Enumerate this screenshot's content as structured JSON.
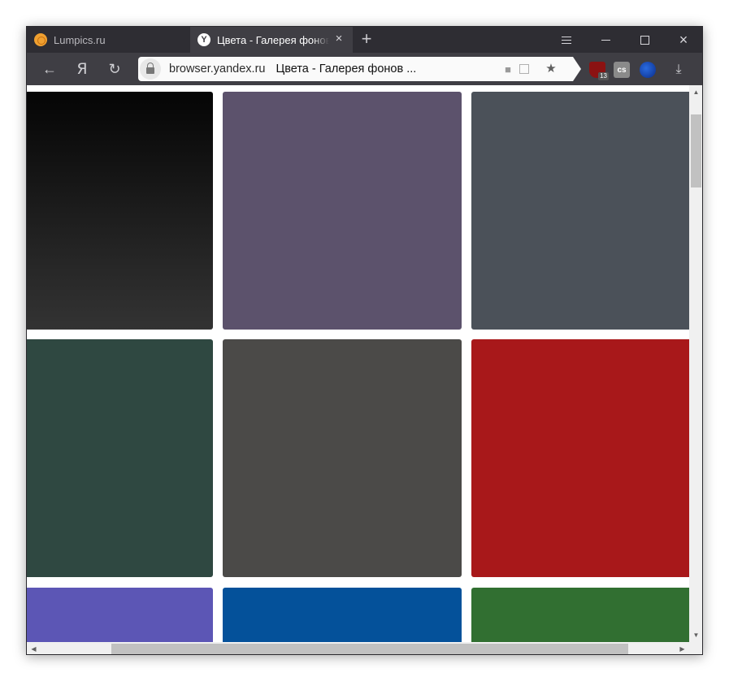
{
  "tabs": [
    {
      "title": "Lumpics.ru",
      "favicon": "lumpics-orange-icon",
      "active": false
    },
    {
      "title": "Цвета - Галерея фонов",
      "favicon": "yandex-y-icon",
      "active": true
    }
  ],
  "new_tab_icon": "plus-icon",
  "window_controls": [
    "menu-icon",
    "minimize-icon",
    "maximize-icon",
    "close-icon"
  ],
  "toolbar": {
    "back_icon": "←",
    "yandex_icon": "Я",
    "reload_icon": "↻",
    "address": {
      "domain": "browser.yandex.ru",
      "page_title": "Цвета - Галерея фонов ..."
    },
    "icons": [
      "chat-icon",
      "translate-icon",
      "star-icon"
    ],
    "extensions": [
      {
        "name": "ublock-origin-icon",
        "badge": "13"
      },
      {
        "name": "lastpass-icon",
        "label": "cs"
      },
      {
        "name": "vpn-globe-icon"
      },
      {
        "name": "download-icon"
      }
    ]
  },
  "gallery": {
    "tiles": [
      {
        "name": "tile-black-gradient",
        "color": "linear-gradient(#050505, #333333)"
      },
      {
        "name": "tile-purple-gray",
        "color": "#5c526c"
      },
      {
        "name": "tile-slate-gray",
        "color": "#4b5159"
      },
      {
        "name": "tile-dark-green",
        "color": "#2f4841"
      },
      {
        "name": "tile-charcoal",
        "color": "#4b4a48"
      },
      {
        "name": "tile-red",
        "color": "#a8181a"
      },
      {
        "name": "tile-violet",
        "color": "#5c56b5"
      },
      {
        "name": "tile-blue",
        "color": "#04519a"
      },
      {
        "name": "tile-green",
        "color": "#316f31"
      }
    ]
  }
}
